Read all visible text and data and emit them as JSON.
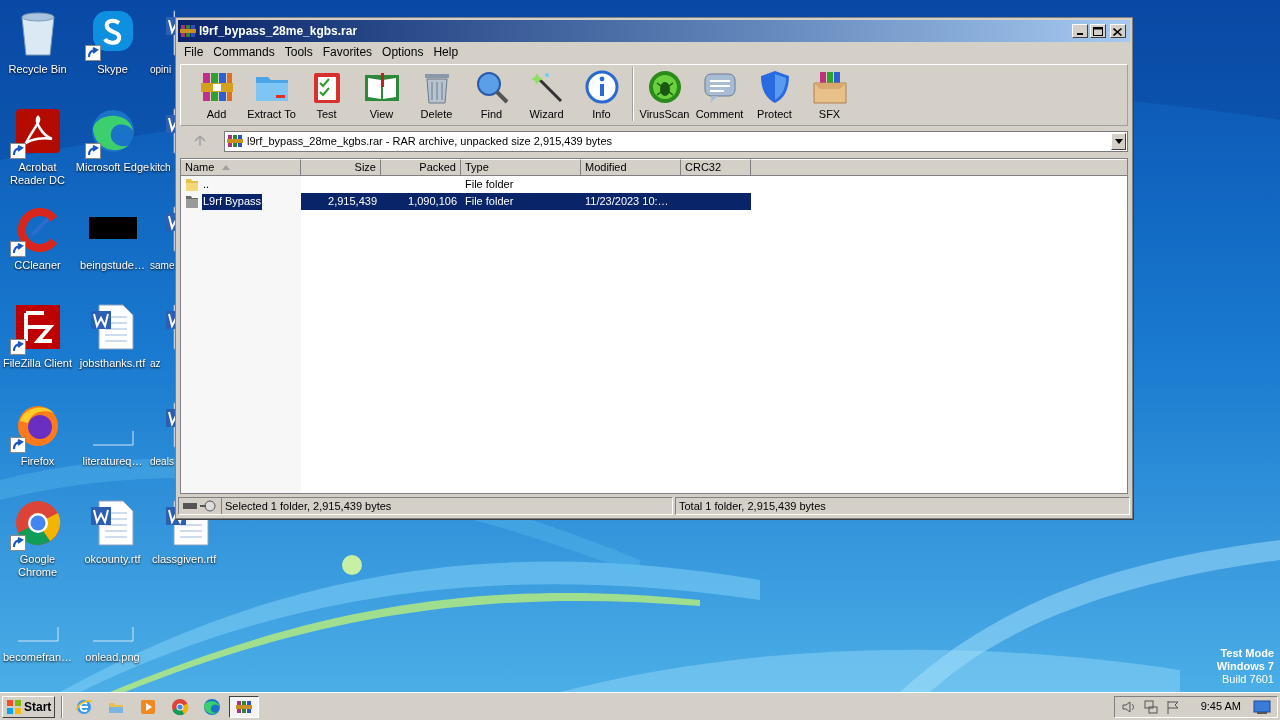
{
  "desktop": {
    "icons": [
      {
        "label": "Recycle Bin",
        "kind": "recycle",
        "shortcut": false
      },
      {
        "label": "Acrobat Reader DC",
        "kind": "acrobat",
        "shortcut": true
      },
      {
        "label": "CCleaner",
        "kind": "ccleaner",
        "shortcut": true
      },
      {
        "label": "FileZilla Client",
        "kind": "filezilla",
        "shortcut": true
      },
      {
        "label": "Firefox",
        "kind": "firefox",
        "shortcut": true
      },
      {
        "label": "Google Chrome",
        "kind": "chrome",
        "shortcut": true
      },
      {
        "label": "becomefran…",
        "kind": "blank",
        "shortcut": false
      },
      {
        "label": "Skype",
        "kind": "skype",
        "shortcut": true
      },
      {
        "label": "Microsoft Edge",
        "kind": "edge",
        "shortcut": true
      },
      {
        "label": "beingstude…",
        "kind": "black",
        "shortcut": false
      },
      {
        "label": "jobsthanks.rtf",
        "kind": "word",
        "shortcut": false
      },
      {
        "label": "literatureq…",
        "kind": "blank",
        "shortcut": false
      },
      {
        "label": "okcounty.rtf",
        "kind": "word",
        "shortcut": false
      },
      {
        "label": "onlead.png",
        "kind": "blank",
        "shortcut": false
      },
      {
        "label": "opini",
        "kind": "word",
        "shortcut": false
      },
      {
        "label": "kitch",
        "kind": "word",
        "shortcut": false
      },
      {
        "label": "same",
        "kind": "word",
        "shortcut": false
      },
      {
        "label": "az",
        "kind": "word",
        "shortcut": false
      },
      {
        "label": "deals",
        "kind": "word",
        "shortcut": false
      },
      {
        "label": "classgiven.rtf",
        "kind": "word",
        "shortcut": false
      }
    ],
    "notice": [
      "Test Mode",
      "Windows 7",
      "Build 7601"
    ]
  },
  "window": {
    "title": "l9rf_bypass_28me_kgbs.rar",
    "menu": [
      "File",
      "Commands",
      "Tools",
      "Favorites",
      "Options",
      "Help"
    ],
    "toolbar": [
      {
        "label": "Add",
        "kind": "add"
      },
      {
        "label": "Extract To",
        "kind": "extract"
      },
      {
        "label": "Test",
        "kind": "test"
      },
      {
        "label": "View",
        "kind": "view"
      },
      {
        "label": "Delete",
        "kind": "delete"
      },
      {
        "label": "Find",
        "kind": "find"
      },
      {
        "label": "Wizard",
        "kind": "wizard"
      },
      {
        "label": "Info",
        "kind": "info"
      },
      {
        "label": "VirusScan",
        "kind": "virus"
      },
      {
        "label": "Comment",
        "kind": "comment"
      },
      {
        "label": "Protect",
        "kind": "protect"
      },
      {
        "label": "SFX",
        "kind": "sfx"
      }
    ],
    "address": "l9rf_bypass_28me_kgbs.rar - RAR archive, unpacked size 2,915,439 bytes",
    "columns": [
      {
        "label": "Name",
        "sorted": true
      },
      {
        "label": "Size",
        "sorted": false
      },
      {
        "label": "Packed",
        "sorted": false
      },
      {
        "label": "Type",
        "sorted": false
      },
      {
        "label": "Modified",
        "sorted": false
      },
      {
        "label": "CRC32",
        "sorted": false
      }
    ],
    "rows": [
      {
        "kind": "up",
        "name": "..",
        "type": "File folder",
        "selected": false
      },
      {
        "kind": "folder",
        "name": "L9rf Bypass",
        "size": "2,915,439",
        "packed": "1,090,106",
        "type": "File folder",
        "modified": "11/23/2023 10:…",
        "selected": true
      }
    ],
    "status": {
      "left": "Selected 1 folder, 2,915,439 bytes",
      "right": "Total 1 folder, 2,915,439 bytes"
    }
  },
  "taskbar": {
    "start": "Start",
    "apps": [
      {
        "kind": "ie",
        "active": false
      },
      {
        "kind": "explorer",
        "active": false
      },
      {
        "kind": "media",
        "active": false
      },
      {
        "kind": "chrome",
        "active": false
      },
      {
        "kind": "edge",
        "active": false
      },
      {
        "kind": "winrar",
        "active": true
      }
    ],
    "time": "9:45 AM"
  }
}
